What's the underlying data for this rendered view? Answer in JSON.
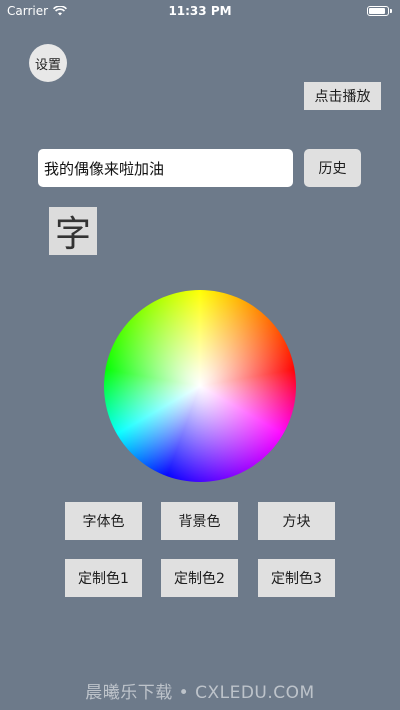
{
  "status_bar": {
    "carrier": "Carrier",
    "time": "11:33 PM",
    "battery_level": 0.9
  },
  "header": {
    "settings_label": "设置",
    "play_label": "点击播放"
  },
  "input": {
    "value": "我的偶像来啦加油"
  },
  "history_label": "历史",
  "preview_char": "字",
  "buttons": {
    "font_color": "字体色",
    "background_color": "背景色",
    "block": "方块",
    "custom1": "定制色1",
    "custom2": "定制色2",
    "custom3": "定制色3"
  },
  "watermark": "晨曦乐下载 • CXLEDU.COM",
  "colors": {
    "background": "#6d7a8a",
    "button_bg": "#e0e0e0",
    "input_bg": "#ffffff"
  }
}
